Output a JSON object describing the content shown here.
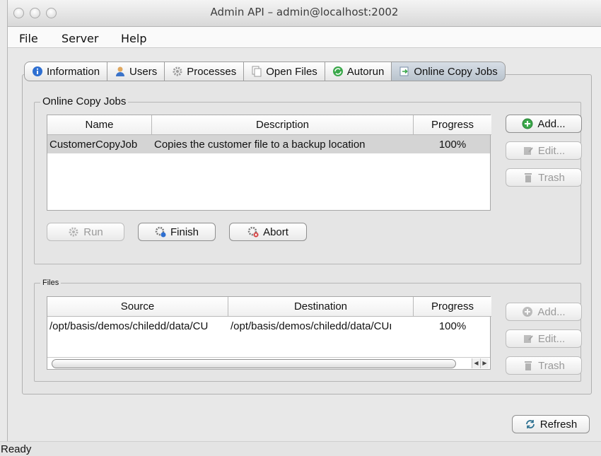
{
  "window": {
    "title": "Admin API – admin@localhost:2002"
  },
  "menu": {
    "file": "File",
    "server": "Server",
    "help": "Help"
  },
  "tabs": [
    {
      "label": "Information",
      "icon": "info-icon"
    },
    {
      "label": "Users",
      "icon": "user-icon"
    },
    {
      "label": "Processes",
      "icon": "gear-icon"
    },
    {
      "label": "Open Files",
      "icon": "files-icon"
    },
    {
      "label": "Autorun",
      "icon": "autorun-icon"
    },
    {
      "label": "Online Copy Jobs",
      "icon": "copy-job-icon",
      "active": true
    }
  ],
  "jobs": {
    "group_title": "Online Copy Jobs",
    "columns": {
      "name": "Name",
      "description": "Description",
      "progress": "Progress"
    },
    "rows": [
      {
        "name": "CustomerCopyJob",
        "description": "Copies the customer file to a backup location",
        "progress": "100%",
        "selected": true
      }
    ],
    "buttons": {
      "add": "Add...",
      "edit": "Edit...",
      "trash": "Trash",
      "run": "Run",
      "finish": "Finish",
      "abort": "Abort"
    }
  },
  "files": {
    "group_title": "Files",
    "columns": {
      "source": "Source",
      "destination": "Destination",
      "progress": "Progress"
    },
    "rows": [
      {
        "source": "/opt/basis/demos/chiledd/data/CU",
        "destination": "/opt/basis/demos/chiledd/data/CUı",
        "progress": "100%"
      }
    ],
    "buttons": {
      "add": "Add...",
      "edit": "Edit...",
      "trash": "Trash"
    }
  },
  "refresh_label": "Refresh",
  "status": "Ready",
  "colors": {
    "add_green": "#3aa84a",
    "info_blue": "#2e6fd1",
    "tab_active": "#c3ccd6"
  }
}
